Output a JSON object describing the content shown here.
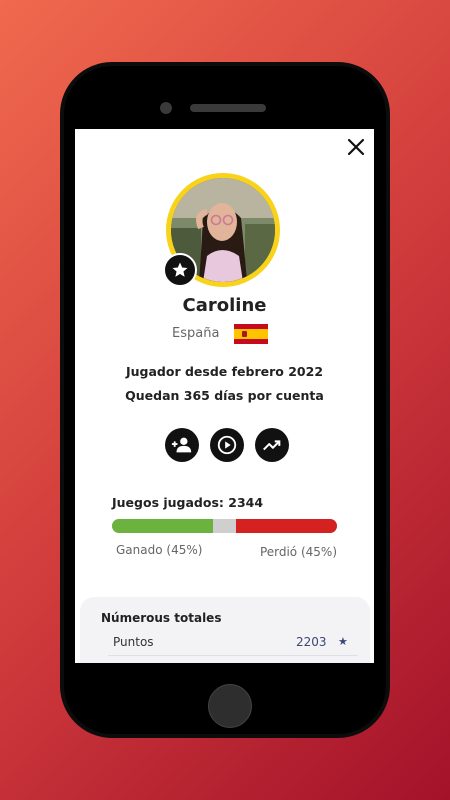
{
  "profile": {
    "name": "Caroline",
    "country": "España",
    "member_since": "Jugador desde febrero 2022",
    "remaining": "Quedan 365 días por cuenta"
  },
  "stats": {
    "games_played": "Juegos jugados: 2344",
    "won_label": "Ganado (45%)",
    "lost_label": "Perdió (45%)",
    "won_fraction": 0.45,
    "lost_fraction": 0.45
  },
  "totals": {
    "title": "Númerous totales",
    "rows": [
      {
        "label": "Puntos",
        "value": "2203",
        "icon": "star-icon"
      }
    ]
  },
  "actions": [
    "add-friend-icon",
    "play-icon",
    "trending-up-icon"
  ],
  "colors": {
    "accent_yellow": "#f8d31a",
    "won_green": "#6bb33e",
    "lost_red": "#d3221f",
    "points_blue": "#3d4577"
  }
}
